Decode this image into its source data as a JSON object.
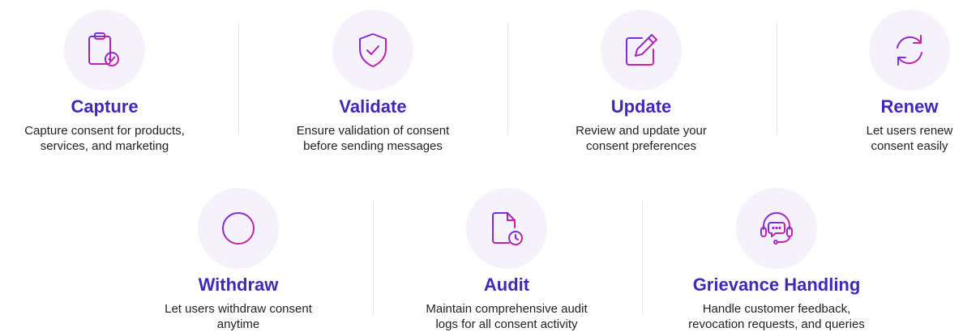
{
  "features": {
    "capture": {
      "title": "Capture",
      "desc": [
        "Capture consent for products,",
        "services, and marketing"
      ]
    },
    "validate": {
      "title": "Validate",
      "desc": [
        "Ensure validation of consent",
        "before sending messages"
      ]
    },
    "update": {
      "title": "Update",
      "desc": [
        "Review and update your",
        "consent preferences"
      ]
    },
    "renew": {
      "title": "Renew",
      "desc": [
        "Let users renew",
        "consent easily"
      ]
    },
    "withdraw": {
      "title": "Withdraw",
      "desc": [
        "Let users withdraw consent",
        "anytime"
      ]
    },
    "audit": {
      "title": "Audit",
      "desc": [
        "Maintain comprehensive audit",
        "logs for all consent activity"
      ]
    },
    "grievance": {
      "title": "Grievance Handling",
      "desc": [
        "Handle customer feedback,",
        "revocation requests, and queries"
      ]
    }
  },
  "icons": {
    "capture": "clipboard-check-icon",
    "validate": "shield-check-icon",
    "update": "pencil-square-icon",
    "renew": "refresh-icon",
    "withdraw": "minus-circle-icon",
    "audit": "document-clock-icon",
    "grievance": "headset-chat-icon"
  },
  "colors": {
    "title": "#4327b8",
    "icon_gradient_start": "#6a2ee8",
    "icon_gradient_end": "#e0208c",
    "icon_circle_bg": "#f6f2fb"
  }
}
